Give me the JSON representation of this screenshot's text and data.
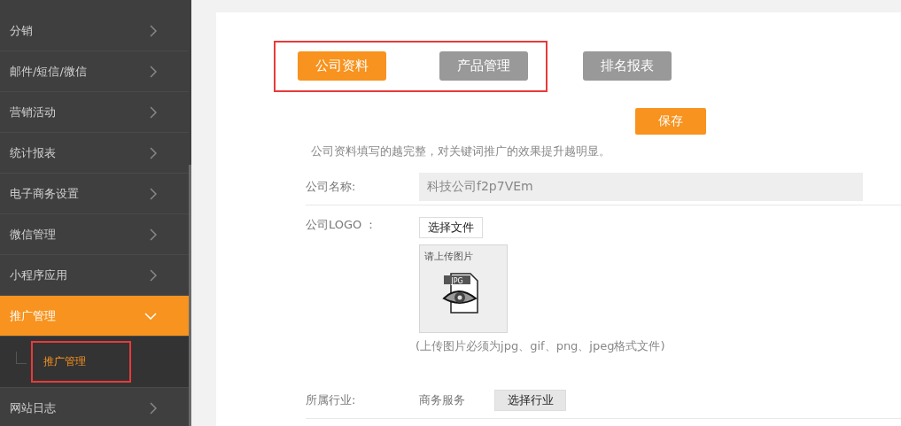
{
  "sidebar": {
    "items": [
      {
        "label": "分销",
        "expanded": false,
        "selected": false
      },
      {
        "label": "邮件/短信/微信",
        "expanded": false,
        "selected": false
      },
      {
        "label": "营销活动",
        "expanded": false,
        "selected": false
      },
      {
        "label": "统计报表",
        "expanded": false,
        "selected": false
      },
      {
        "label": "电子商务设置",
        "expanded": false,
        "selected": false
      },
      {
        "label": "微信管理",
        "expanded": false,
        "selected": false
      },
      {
        "label": "小程序应用",
        "expanded": false,
        "selected": false
      },
      {
        "label": "推广管理",
        "expanded": true,
        "selected": true,
        "children": [
          {
            "label": "推广管理",
            "selected": true,
            "highlighted": true
          }
        ]
      },
      {
        "label": "网站日志",
        "expanded": false,
        "selected": false
      }
    ]
  },
  "tabs": {
    "highlighted": true,
    "items": [
      {
        "label": "公司资料",
        "selected": true
      },
      {
        "label": "产品管理",
        "selected": false
      },
      {
        "label": "排名报表",
        "selected": false
      }
    ]
  },
  "save_button": "保存",
  "hint": "公司资料填写的越完整，对关键词推广的效果提升越明显。",
  "company_name": {
    "label": "公司名称:",
    "value": "科技公司f2p7VEm"
  },
  "logo": {
    "label": "公司LOGO ：",
    "choose_button": "选择文件",
    "placeholder": "请上传图片",
    "icon_label": "JPG",
    "note": "(上传图片必须为jpg、gif、png、jpeg格式文件)"
  },
  "industry": {
    "label": "所属行业:",
    "value": "商务服务",
    "choose_button": "选择行业"
  }
}
